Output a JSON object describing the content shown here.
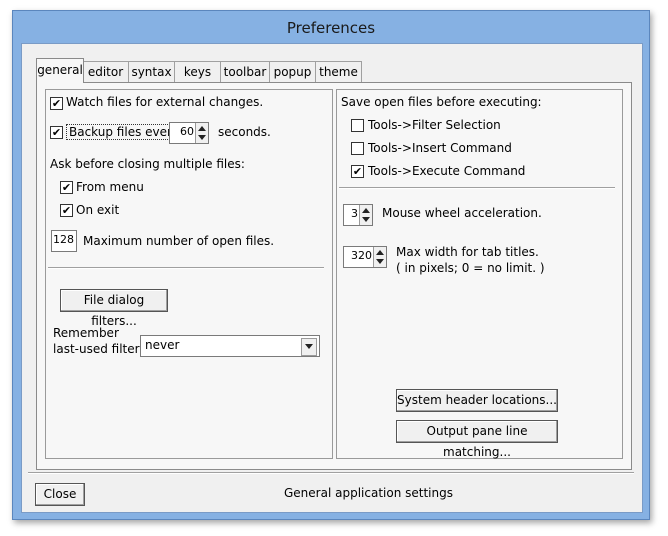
{
  "window": {
    "title": "Preferences"
  },
  "tabs": [
    "general",
    "editor",
    "syntax",
    "keys",
    "toolbar",
    "popup",
    "theme"
  ],
  "left": {
    "watch_files": {
      "label": "Watch files for external changes.",
      "checked": true
    },
    "backup_files": {
      "label": "Backup files every",
      "checked": true,
      "value": "60",
      "suffix": "seconds."
    },
    "ask_closing": {
      "label": "Ask before closing multiple files:"
    },
    "from_menu": {
      "label": "From menu",
      "checked": true
    },
    "on_exit": {
      "label": "On exit",
      "checked": true
    },
    "max_open": {
      "value": "128",
      "label": "Maximum number of open files."
    },
    "file_dialog_button": "File dialog filters...",
    "remember_label_1": "Remember",
    "remember_label_2": "last-used filter :",
    "remember_select": "never"
  },
  "right": {
    "save_heading": "Save open files before executing:",
    "filter_selection": {
      "label": "Tools->Filter Selection",
      "checked": false
    },
    "insert_command": {
      "label": "Tools->Insert Command",
      "checked": false
    },
    "execute_command": {
      "label": "Tools->Execute Command",
      "checked": true
    },
    "mouse_wheel": {
      "value": "3",
      "label": "Mouse wheel acceleration."
    },
    "tab_width": {
      "value": "320",
      "label_1": "Max width for tab titles.",
      "label_2": "( in pixels;  0 = no limit. )"
    },
    "system_header_button": "System header locations...",
    "output_pane_button": "Output pane line matching..."
  },
  "footer": {
    "close_button": "Close",
    "status": "General application settings"
  },
  "check_mark": "✔"
}
